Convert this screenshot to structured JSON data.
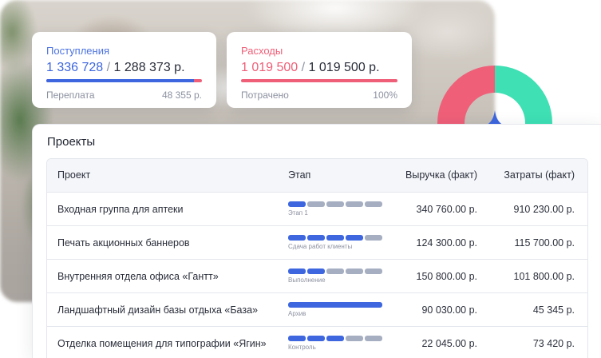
{
  "income": {
    "label": "Поступления",
    "value_main": "1 336 728",
    "separator": "/",
    "value_total": "1 288 373 р.",
    "progress": 0.95,
    "foot_label": "Переплата",
    "foot_value": "48 355 р."
  },
  "expense": {
    "label": "Расходы",
    "value_main": "1 019 500",
    "separator": "/",
    "value_total": "1 019 500 р.",
    "progress": 1.0,
    "foot_label": "Потрачено",
    "foot_value": "100%"
  },
  "colors": {
    "blue": "#3d66df",
    "pink": "#ef5f78",
    "teal": "#3ee0b4",
    "gray_segment": "#a6afc2"
  },
  "panel": {
    "title": "Проекты",
    "columns": {
      "project": "Проект",
      "stage": "Этап",
      "revenue": "Выручка (факт)",
      "cost": "Затраты (факт)"
    },
    "rows": [
      {
        "project": "Входная группа для аптеки",
        "stage": "Этап 1",
        "stage_done": 1,
        "stage_total": 5,
        "revenue": "340 760.00 р.",
        "cost": "910 230.00 р."
      },
      {
        "project": "Печать акционных баннеров",
        "stage": "Сдача работ клиенты",
        "stage_done": 4,
        "stage_total": 5,
        "revenue": "124 300.00 р.",
        "cost": "115 700.00 р."
      },
      {
        "project": "Внутренняя отдела офиса «Гантт»",
        "stage": "Выполнение",
        "stage_done": 2,
        "stage_total": 5,
        "revenue": "150 800.00 р.",
        "cost": "101 800.00 р."
      },
      {
        "project": "Ландшафтный дизайн базы отдыха «База»",
        "stage": "Архив",
        "stage_done": 1,
        "stage_total": 1,
        "revenue": "90 030.00 р.",
        "cost": "45 345 р."
      },
      {
        "project": "Отделка помещения для типографии «Ягин»",
        "stage": "Контроль",
        "stage_done": 3,
        "stage_total": 5,
        "revenue": "22 045.00 р.",
        "cost": "73 420 р."
      }
    ]
  }
}
